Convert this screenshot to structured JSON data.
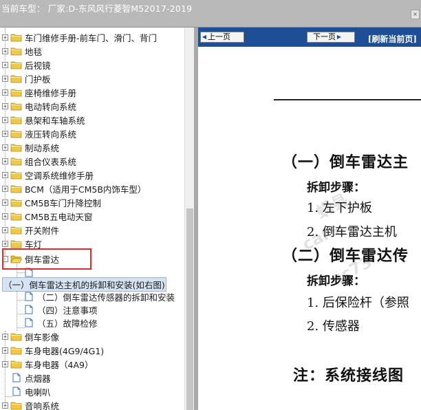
{
  "window": {
    "title": "当前车型： 厂家:D-东风风行菱智M52017-2019"
  },
  "tree": {
    "items": [
      {
        "label": "车门维修手册-前车门、滑门、背门",
        "kind": "folder",
        "expander": "+"
      },
      {
        "label": "地毯",
        "kind": "folder",
        "expander": "+"
      },
      {
        "label": "后视镜",
        "kind": "folder",
        "expander": "+"
      },
      {
        "label": "门护板",
        "kind": "folder",
        "expander": "+"
      },
      {
        "label": "座椅维修手册",
        "kind": "folder",
        "expander": "+"
      },
      {
        "label": "电动转向系统",
        "kind": "folder",
        "expander": "+"
      },
      {
        "label": "悬架和车轴系统",
        "kind": "folder",
        "expander": "+"
      },
      {
        "label": "液压转向系统",
        "kind": "folder",
        "expander": "+"
      },
      {
        "label": "制动系统",
        "kind": "folder",
        "expander": "+"
      },
      {
        "label": "组合仪表系统",
        "kind": "folder",
        "expander": "+"
      },
      {
        "label": "空调系统维修手册",
        "kind": "folder",
        "expander": "+"
      },
      {
        "label": "BCM（适用于CM5B内饰车型）",
        "kind": "folder",
        "expander": "+"
      },
      {
        "label": "CM5B车门升降控制",
        "kind": "folder",
        "expander": "+"
      },
      {
        "label": "CM5B五电动天窗",
        "kind": "folder",
        "expander": "+"
      },
      {
        "label": "开关附件",
        "kind": "folder",
        "expander": "+"
      },
      {
        "label": "车灯",
        "kind": "folder",
        "expander": "+"
      },
      {
        "label": "倒车雷达",
        "kind": "folder-open",
        "expander": "-"
      },
      {
        "label": "",
        "kind": "doc"
      },
      {
        "label": "（一）倒车雷达主机的拆卸和安装(如右图)",
        "kind": "selected"
      },
      {
        "label": "（二）倒车雷达传感器的拆卸和安装",
        "kind": "doc"
      },
      {
        "label": "（四）注意事项",
        "kind": "doc"
      },
      {
        "label": "（五）故障检修",
        "kind": "doc"
      },
      {
        "label": "倒车影像",
        "kind": "folder",
        "expander": "+"
      },
      {
        "label": "车身电器(4G9/4G1)",
        "kind": "folder",
        "expander": "+"
      },
      {
        "label": "车身电器（4A9）",
        "kind": "folder",
        "expander": "+"
      },
      {
        "label": "点烟器",
        "kind": "doc"
      },
      {
        "label": "电喇叭",
        "kind": "doc"
      },
      {
        "label": "音响系统",
        "kind": "folder",
        "expander": "+"
      }
    ]
  },
  "nav": {
    "prev_label": "上一页",
    "next_label": "下一页",
    "refresh_label": "[刷新当前页]"
  },
  "document": {
    "heading1": "（一）倒车雷达主",
    "steps_label_1": "拆卸步骤：",
    "step_1_1": "1. 左下护板",
    "step_1_2": "2. 倒车雷达主机",
    "heading2": "（二）倒车雷达传",
    "steps_label_2": "拆卸步骤：",
    "step_2_1": "1. 后保险杆（参照",
    "step_2_2": "2. 传感器",
    "note": "注：系统接线图"
  },
  "watermarks": [
    "蜗县",
    "cars",
    "qc73"
  ],
  "colors": {
    "navbar": "#1d4e96",
    "highlight": "#e12a2a",
    "folder": "#f0c842",
    "selection": "#d6e3f3"
  }
}
